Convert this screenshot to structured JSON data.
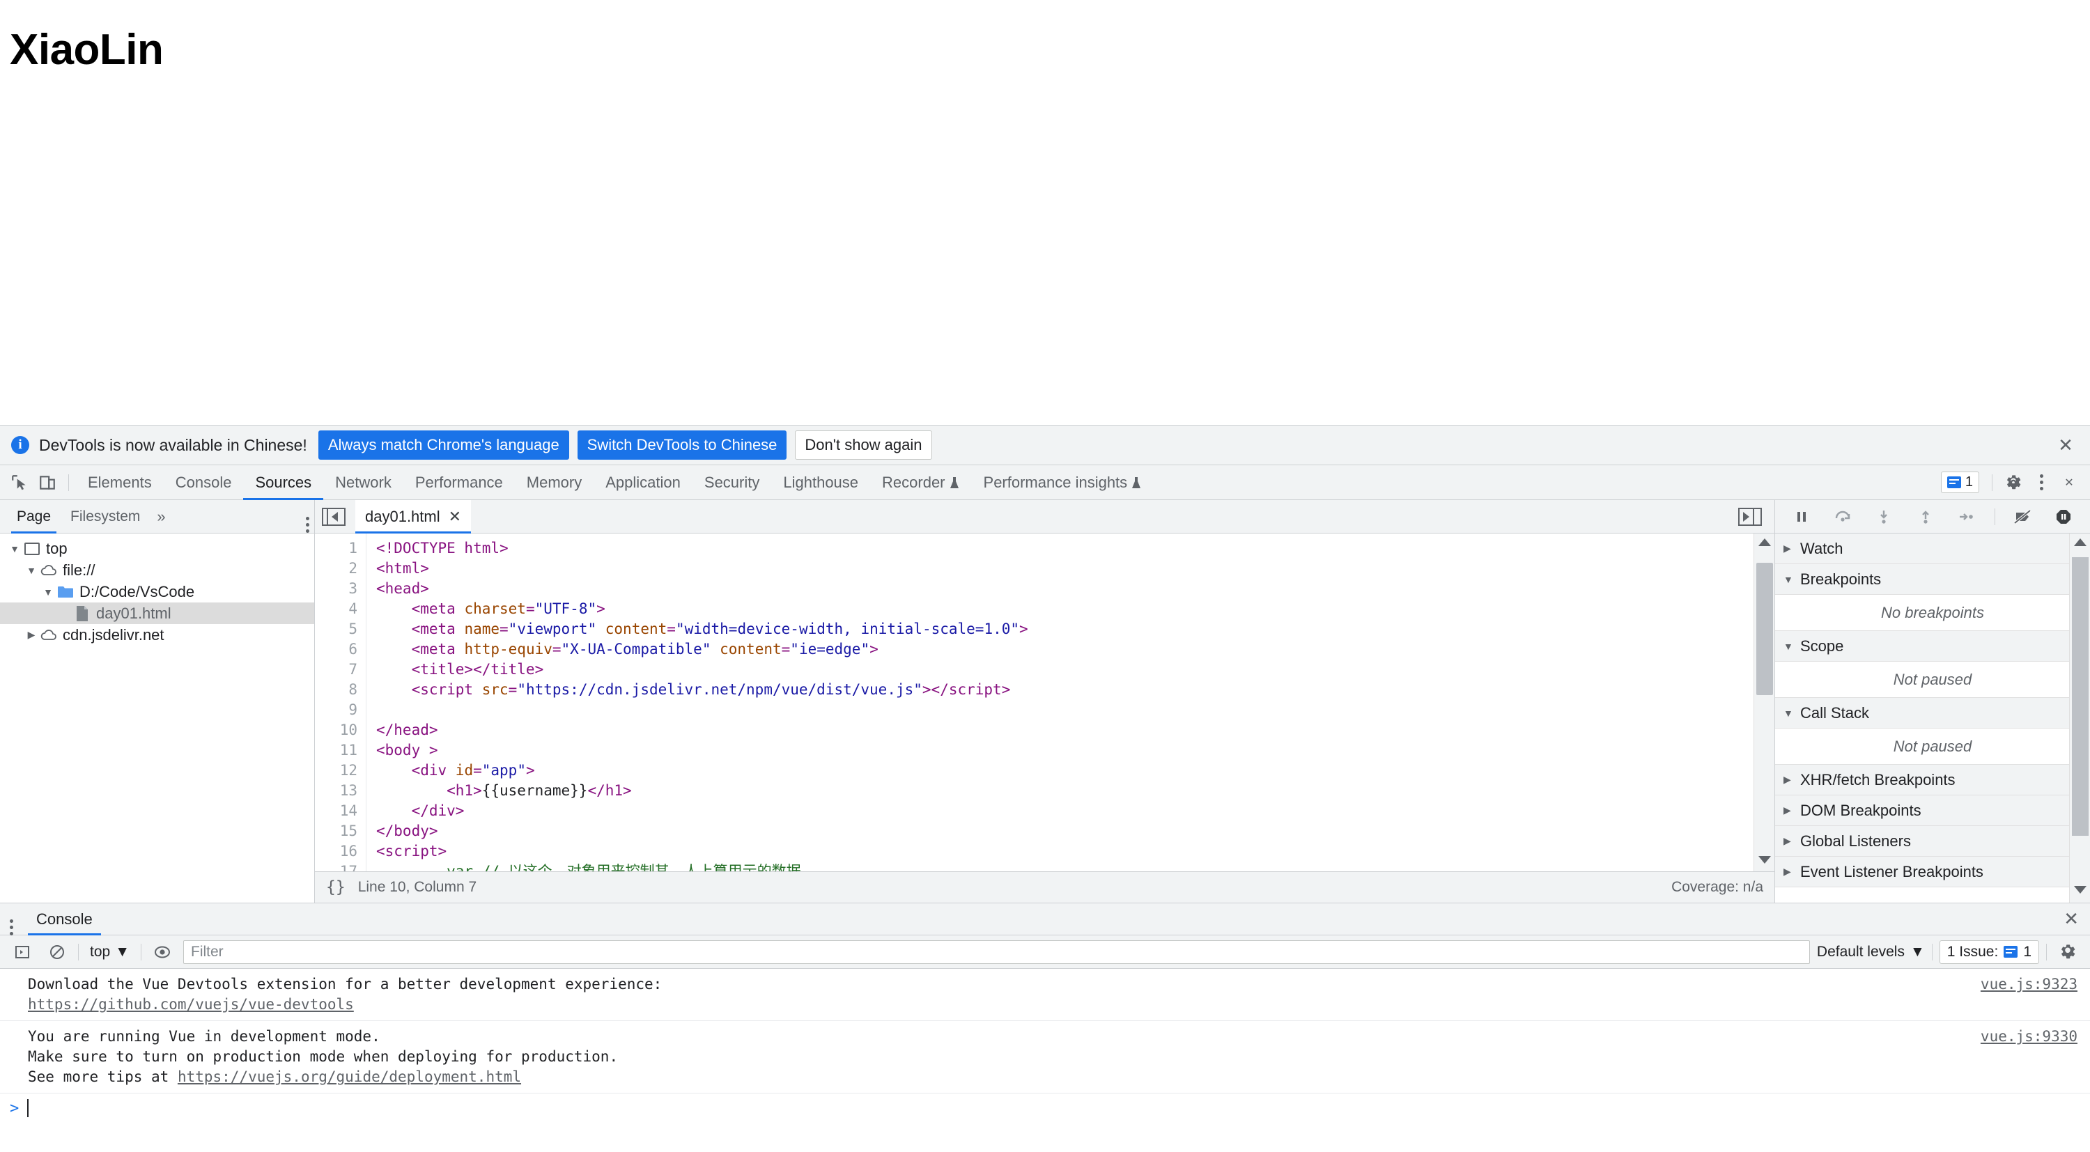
{
  "page": {
    "heading": "XiaoLin"
  },
  "notification": {
    "icon": "info-icon",
    "message": "DevTools is now available in Chinese!",
    "buttons": [
      {
        "label": "Always match Chrome's language",
        "style": "primary"
      },
      {
        "label": "Switch DevTools to Chinese",
        "style": "primary"
      },
      {
        "label": "Don't show again",
        "style": "plain"
      }
    ],
    "close_label": "✕"
  },
  "devtools": {
    "tabs": [
      {
        "label": "Elements",
        "active": false,
        "flask": false
      },
      {
        "label": "Console",
        "active": false,
        "flask": false
      },
      {
        "label": "Sources",
        "active": true,
        "flask": false
      },
      {
        "label": "Network",
        "active": false,
        "flask": false
      },
      {
        "label": "Performance",
        "active": false,
        "flask": false
      },
      {
        "label": "Memory",
        "active": false,
        "flask": false
      },
      {
        "label": "Application",
        "active": false,
        "flask": false
      },
      {
        "label": "Security",
        "active": false,
        "flask": false
      },
      {
        "label": "Lighthouse",
        "active": false,
        "flask": false
      },
      {
        "label": "Recorder",
        "active": false,
        "flask": true
      },
      {
        "label": "Performance insights",
        "active": false,
        "flask": true
      }
    ],
    "issues_count": "1",
    "settings_label": "gear-icon",
    "more_label": "kebab-icon",
    "close_label": "✕"
  },
  "navigator": {
    "tabs": [
      {
        "label": "Page",
        "active": true
      },
      {
        "label": "Filesystem",
        "active": false
      }
    ],
    "more": "»",
    "tree": [
      {
        "label": "top",
        "icon": "frame-icon",
        "expanded": true,
        "indent": 0,
        "selected": false,
        "muted": false
      },
      {
        "label": "file://",
        "icon": "cloud-icon",
        "expanded": true,
        "indent": 1,
        "selected": false,
        "muted": false
      },
      {
        "label": "D:/Code/VsCode",
        "icon": "folder-icon",
        "expanded": true,
        "indent": 2,
        "selected": false,
        "muted": false
      },
      {
        "label": "day01.html",
        "icon": "file-icon",
        "expanded": null,
        "indent": 3,
        "selected": true,
        "muted": true
      },
      {
        "label": "cdn.jsdelivr.net",
        "icon": "cloud-icon",
        "expanded": false,
        "indent": 1,
        "selected": false,
        "muted": false
      }
    ]
  },
  "editor": {
    "tab_name": "day01.html",
    "tab_close": "✕",
    "status_line": "Line 10, Column 7",
    "status_format": "{}",
    "coverage": "Coverage: n/a",
    "lines": [
      {
        "n": "1",
        "tokens": [
          {
            "t": "tag",
            "v": "<!DOCTYPE html>"
          }
        ]
      },
      {
        "n": "2",
        "tokens": [
          {
            "t": "tag",
            "v": "<html>"
          }
        ]
      },
      {
        "n": "3",
        "tokens": [
          {
            "t": "tag",
            "v": "<head>"
          }
        ]
      },
      {
        "n": "4",
        "tokens": [
          {
            "t": "tag",
            "v": "    <meta "
          },
          {
            "t": "attr",
            "v": "charset"
          },
          {
            "t": "tag",
            "v": "="
          },
          {
            "t": "val",
            "v": "\"UTF-8\""
          },
          {
            "t": "tag",
            "v": ">"
          }
        ]
      },
      {
        "n": "5",
        "tokens": [
          {
            "t": "tag",
            "v": "    <meta "
          },
          {
            "t": "attr",
            "v": "name"
          },
          {
            "t": "tag",
            "v": "="
          },
          {
            "t": "val",
            "v": "\"viewport\""
          },
          {
            "t": "tag",
            "v": " "
          },
          {
            "t": "attr",
            "v": "content"
          },
          {
            "t": "tag",
            "v": "="
          },
          {
            "t": "val",
            "v": "\"width=device-width, initial-scale=1.0\""
          },
          {
            "t": "tag",
            "v": ">"
          }
        ]
      },
      {
        "n": "6",
        "tokens": [
          {
            "t": "tag",
            "v": "    <meta "
          },
          {
            "t": "attr",
            "v": "http-equiv"
          },
          {
            "t": "tag",
            "v": "="
          },
          {
            "t": "val",
            "v": "\"X-UA-Compatible\""
          },
          {
            "t": "tag",
            "v": " "
          },
          {
            "t": "attr",
            "v": "content"
          },
          {
            "t": "tag",
            "v": "="
          },
          {
            "t": "val",
            "v": "\"ie=edge\""
          },
          {
            "t": "tag",
            "v": ">"
          }
        ]
      },
      {
        "n": "7",
        "tokens": [
          {
            "t": "tag",
            "v": "    <title></title>"
          }
        ]
      },
      {
        "n": "8",
        "tokens": [
          {
            "t": "tag",
            "v": "    <script "
          },
          {
            "t": "attr",
            "v": "src"
          },
          {
            "t": "tag",
            "v": "="
          },
          {
            "t": "val",
            "v": "\"https://cdn.jsdelivr.net/npm/vue/dist/vue.js\""
          },
          {
            "t": "tag",
            "v": "></script>"
          }
        ]
      },
      {
        "n": "9",
        "tokens": []
      },
      {
        "n": "10",
        "tokens": [
          {
            "t": "tag",
            "v": "</head>"
          }
        ]
      },
      {
        "n": "11",
        "tokens": [
          {
            "t": "tag",
            "v": "<body >"
          }
        ]
      },
      {
        "n": "12",
        "tokens": [
          {
            "t": "tag",
            "v": "    <div "
          },
          {
            "t": "attr",
            "v": "id"
          },
          {
            "t": "tag",
            "v": "="
          },
          {
            "t": "val",
            "v": "\"app\""
          },
          {
            "t": "tag",
            "v": ">"
          }
        ]
      },
      {
        "n": "13",
        "tokens": [
          {
            "t": "tag",
            "v": "        <h1>"
          },
          {
            "t": "txt",
            "v": "{{username}}"
          },
          {
            "t": "tag",
            "v": "</h1>"
          }
        ]
      },
      {
        "n": "14",
        "tokens": [
          {
            "t": "tag",
            "v": "    </div>"
          }
        ]
      },
      {
        "n": "15",
        "tokens": [
          {
            "t": "tag",
            "v": "</body>"
          }
        ]
      },
      {
        "n": "16",
        "tokens": [
          {
            "t": "tag",
            "v": "<script>"
          }
        ]
      },
      {
        "n": "17",
        "tokens": [
          {
            "t": "com",
            "v": "        var // 以这个、对象用来控制其、人上算用示的数据"
          }
        ]
      }
    ]
  },
  "debugger": {
    "controls": [
      "pause-icon",
      "step-over-icon",
      "step-into-icon",
      "step-out-icon",
      "step-icon",
      "deactivate-breakpoints-icon",
      "pause-on-exceptions-icon"
    ],
    "sections": [
      {
        "title": "Watch",
        "expanded": false,
        "empty": null
      },
      {
        "title": "Breakpoints",
        "expanded": true,
        "empty": "No breakpoints"
      },
      {
        "title": "Scope",
        "expanded": true,
        "empty": "Not paused"
      },
      {
        "title": "Call Stack",
        "expanded": true,
        "empty": "Not paused"
      },
      {
        "title": "XHR/fetch Breakpoints",
        "expanded": false,
        "empty": null
      },
      {
        "title": "DOM Breakpoints",
        "expanded": false,
        "empty": null
      },
      {
        "title": "Global Listeners",
        "expanded": false,
        "empty": null
      },
      {
        "title": "Event Listener Breakpoints",
        "expanded": false,
        "empty": null
      }
    ]
  },
  "drawer": {
    "tab": "Console",
    "close_label": "✕",
    "toolbar": {
      "sidebar_icon": "console-sidebar-icon",
      "clear_icon": "clear-console-icon",
      "context": "top",
      "eye_icon": "live-expression-icon",
      "filter_placeholder": "Filter",
      "filter_value": "",
      "levels": "Default levels",
      "issues": "1 Issue:",
      "issues_count": "1",
      "settings_icon": "gear-icon"
    },
    "messages": [
      {
        "lines": [
          {
            "text": "Download the Vue Devtools extension for a better development experience:",
            "link": false
          },
          {
            "text": "https://github.com/vuejs/vue-devtools",
            "link": true
          }
        ],
        "source": "vue.js:9323"
      },
      {
        "lines": [
          {
            "text": "You are running Vue in development mode.",
            "link": false
          },
          {
            "text": "Make sure to turn on production mode when deploying for production.",
            "link": false
          },
          {
            "text": "See more tips at ",
            "link": false,
            "suffix_link": "https://vuejs.org/guide/deployment.html"
          }
        ],
        "source": "vue.js:9330"
      }
    ],
    "prompt": ">"
  },
  "colors": {
    "accent": "#1a73e8",
    "toolbar_bg": "#f1f3f4",
    "border": "#cdd0d3",
    "text": "#202124",
    "muted": "#5f6368",
    "selected_row": "#dcdcdc"
  }
}
